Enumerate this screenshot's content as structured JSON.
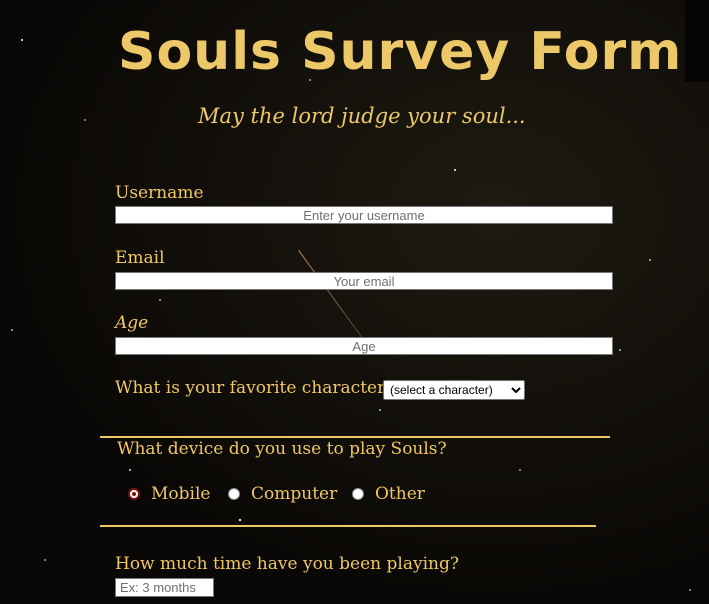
{
  "header": {
    "title": "Souls Survey Form",
    "subtitle": "May the lord judge your soul..."
  },
  "form": {
    "username": {
      "label": "Username",
      "placeholder": "Enter your username",
      "value": ""
    },
    "email": {
      "label": "Email",
      "placeholder": "Your email",
      "value": ""
    },
    "age": {
      "label": "Age",
      "placeholder": "Age",
      "value": ""
    },
    "character": {
      "label": "What is your favorite character?",
      "selected": "(select a character)"
    },
    "device": {
      "question": "What device do you use to play Souls?",
      "options": [
        {
          "label": "Mobile",
          "checked": true
        },
        {
          "label": "Computer",
          "checked": false
        },
        {
          "label": "Other",
          "checked": false
        }
      ]
    },
    "playtime": {
      "question": "How much time have you been playing?",
      "placeholder": "Ex: 3 months",
      "value": ""
    }
  },
  "colors": {
    "accent": "#f0c764",
    "title": "#ecc868",
    "background": "#0d0b08",
    "radio_checked": "#7b1015"
  }
}
